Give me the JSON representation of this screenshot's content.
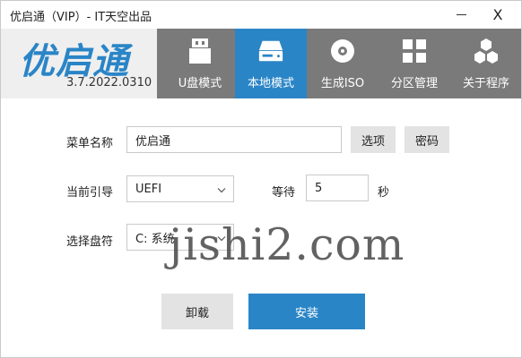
{
  "window": {
    "title": "优启通（VIP）- IT天空出品"
  },
  "titlebar": {
    "minimize_icon": "minimize-icon",
    "close_label": "X"
  },
  "header": {
    "logo": "优启通",
    "version": "3.7.2022.0310",
    "tabs": [
      {
        "label": "U盘模式",
        "icon": "usb-drive-icon",
        "active": false
      },
      {
        "label": "本地模式",
        "icon": "hard-disk-icon",
        "active": true
      },
      {
        "label": "生成ISO",
        "icon": "disc-icon",
        "active": false
      },
      {
        "label": "分区管理",
        "icon": "partition-grid-icon",
        "active": false
      },
      {
        "label": "关于程序",
        "icon": "hexagons-icon",
        "active": false
      }
    ],
    "colors": {
      "accent": "#2a85c7",
      "tab_bar": "#7a7a7a",
      "logo_bg": "#efefef"
    }
  },
  "form": {
    "menu_name": {
      "label": "菜单名称",
      "value": "优启通"
    },
    "options_button": "选项",
    "password_button": "密码",
    "boot": {
      "label": "当前引导",
      "value": "UEFI"
    },
    "wait": {
      "label": "等待",
      "value": "5",
      "unit": "秒"
    },
    "disk": {
      "label": "选择盘符",
      "value": "C: 系统"
    }
  },
  "actions": {
    "uninstall": "卸载",
    "install": "安装"
  },
  "watermark": "jishi2.com"
}
